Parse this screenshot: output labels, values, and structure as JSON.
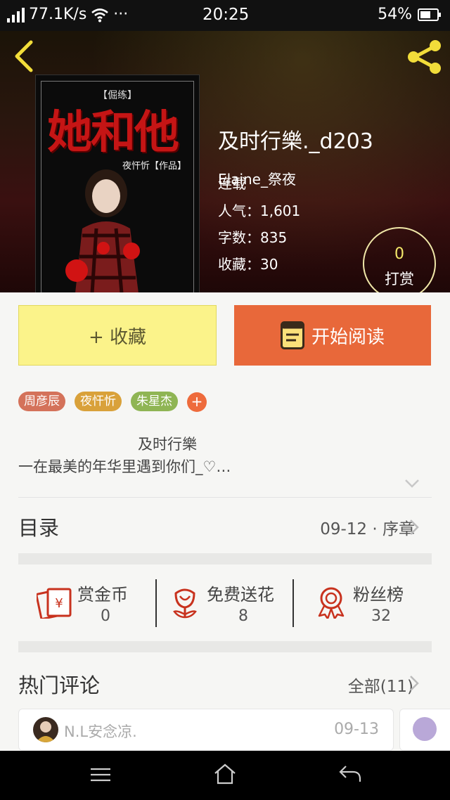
{
  "status_bar": {
    "speed": "77.1K/s",
    "dots": "···",
    "time": "20:25",
    "battery": "54%"
  },
  "book": {
    "title": "及时行樂._d203",
    "author": "Elaine_祭夜",
    "status": "连载",
    "popularity_label": "人气：",
    "popularity": "1,601",
    "words_label": "字数：",
    "words": "835",
    "favorites_label": "收藏：",
    "favorites": "30",
    "cover": {
      "subtitle": "【倔练】",
      "title": "她和他",
      "byline": "夜忓忻【作品】"
    }
  },
  "reward": {
    "count": "0",
    "label": "打赏"
  },
  "buttons": {
    "collect": "+ 收藏",
    "read": "开始阅读"
  },
  "tags": [
    {
      "label": "周彦辰",
      "color": "#d4725a"
    },
    {
      "label": "夜忓忻",
      "color": "#d9a13a"
    },
    {
      "label": "朱星杰",
      "color": "#8fb554"
    }
  ],
  "tag_add": "+",
  "intro": {
    "line1": "及时行樂",
    "line2": "一在最美的年华里遇到你们_♡…"
  },
  "toc": {
    "title": "目录",
    "info": "09-12 · 序章"
  },
  "stats": [
    {
      "label": "赏金币",
      "value": "0",
      "icon": "coin-envelope-icon"
    },
    {
      "label": "免费送花",
      "value": "8",
      "icon": "flower-icon"
    },
    {
      "label": "粉丝榜",
      "value": "32",
      "icon": "medal-icon"
    }
  ],
  "comments": {
    "title": "热门评论",
    "all": "全部(11)",
    "items": [
      {
        "user": "N.L安念凉.",
        "date": "09-13"
      }
    ]
  },
  "colors": {
    "accent": "#e8683a",
    "collect_bg": "#fbf38a",
    "icon_red": "#c8321e"
  }
}
